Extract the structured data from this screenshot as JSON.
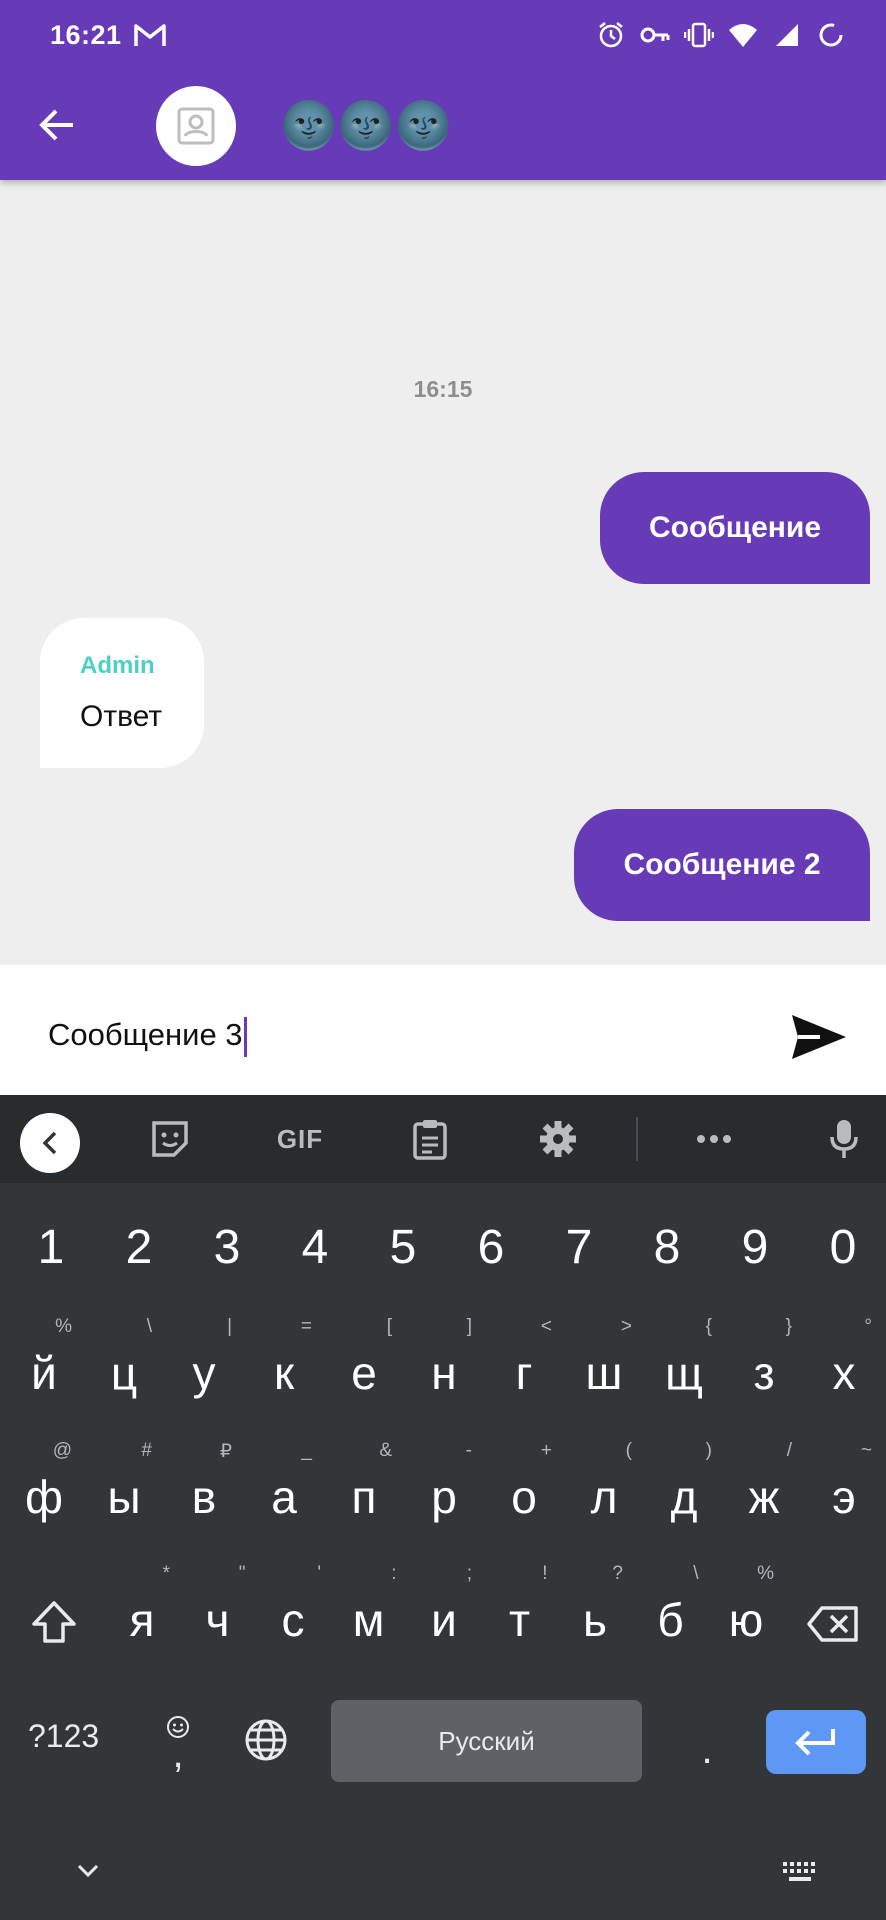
{
  "status_bar": {
    "time": "16:21"
  },
  "app_bar": {
    "title": "🌚🌚🌚"
  },
  "chat": {
    "date_label": "16:15",
    "messages": [
      {
        "direction": "out",
        "text": "Сообщение"
      },
      {
        "direction": "in",
        "sender": "Admin",
        "text": "Ответ"
      },
      {
        "direction": "out",
        "text": "Сообщение 2"
      }
    ]
  },
  "composer": {
    "value": "Сообщение 3"
  },
  "keyboard": {
    "toolbar": {
      "gif_label": "GIF"
    },
    "number_row": [
      "1",
      "2",
      "3",
      "4",
      "5",
      "6",
      "7",
      "8",
      "9",
      "0"
    ],
    "row1": [
      {
        "k": "й",
        "h": "%"
      },
      {
        "k": "ц",
        "h": "\\"
      },
      {
        "k": "у",
        "h": "|"
      },
      {
        "k": "к",
        "h": "="
      },
      {
        "k": "е",
        "h": "["
      },
      {
        "k": "н",
        "h": "]"
      },
      {
        "k": "г",
        "h": "<"
      },
      {
        "k": "ш",
        "h": ">"
      },
      {
        "k": "щ",
        "h": "{"
      },
      {
        "k": "з",
        "h": "}"
      },
      {
        "k": "х",
        "h": "°"
      }
    ],
    "row2": [
      {
        "k": "ф",
        "h": "@"
      },
      {
        "k": "ы",
        "h": "#"
      },
      {
        "k": "в",
        "h": "₽"
      },
      {
        "k": "а",
        "h": "_"
      },
      {
        "k": "п",
        "h": "&"
      },
      {
        "k": "р",
        "h": "-"
      },
      {
        "k": "о",
        "h": "+"
      },
      {
        "k": "л",
        "h": "("
      },
      {
        "k": "д",
        "h": ")"
      },
      {
        "k": "ж",
        "h": "/"
      },
      {
        "k": "э",
        "h": "~"
      }
    ],
    "row3": [
      {
        "k": "я",
        "h": "*"
      },
      {
        "k": "ч",
        "h": "\""
      },
      {
        "k": "с",
        "h": "'"
      },
      {
        "k": "м",
        "h": ":"
      },
      {
        "k": "и",
        "h": ";"
      },
      {
        "k": "т",
        "h": "!"
      },
      {
        "k": "ь",
        "h": "?"
      },
      {
        "k": "б",
        "h": "\\"
      },
      {
        "k": "ю",
        "h": "%"
      }
    ],
    "symbols_key": "?123",
    "comma_key": ",",
    "period_key": ".",
    "space_label": "Русский"
  },
  "colors": {
    "primary": "#673ab7",
    "sender": "#4dd0c4",
    "enter": "#5e97f6",
    "keyboard_bg": "#323639"
  }
}
